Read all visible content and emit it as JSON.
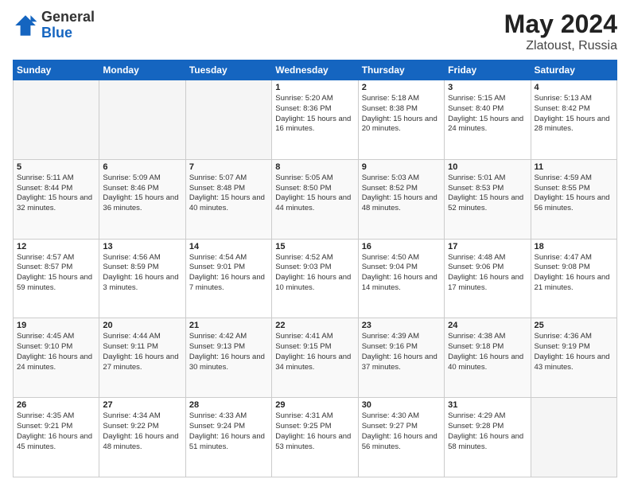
{
  "header": {
    "logo_general": "General",
    "logo_blue": "Blue",
    "title": "May 2024",
    "location": "Zlatoust, Russia"
  },
  "days_of_week": [
    "Sunday",
    "Monday",
    "Tuesday",
    "Wednesday",
    "Thursday",
    "Friday",
    "Saturday"
  ],
  "weeks": [
    [
      {
        "day": "",
        "info": ""
      },
      {
        "day": "",
        "info": ""
      },
      {
        "day": "",
        "info": ""
      },
      {
        "day": "1",
        "info": "Sunrise: 5:20 AM\nSunset: 8:36 PM\nDaylight: 15 hours\nand 16 minutes."
      },
      {
        "day": "2",
        "info": "Sunrise: 5:18 AM\nSunset: 8:38 PM\nDaylight: 15 hours\nand 20 minutes."
      },
      {
        "day": "3",
        "info": "Sunrise: 5:15 AM\nSunset: 8:40 PM\nDaylight: 15 hours\nand 24 minutes."
      },
      {
        "day": "4",
        "info": "Sunrise: 5:13 AM\nSunset: 8:42 PM\nDaylight: 15 hours\nand 28 minutes."
      }
    ],
    [
      {
        "day": "5",
        "info": "Sunrise: 5:11 AM\nSunset: 8:44 PM\nDaylight: 15 hours\nand 32 minutes."
      },
      {
        "day": "6",
        "info": "Sunrise: 5:09 AM\nSunset: 8:46 PM\nDaylight: 15 hours\nand 36 minutes."
      },
      {
        "day": "7",
        "info": "Sunrise: 5:07 AM\nSunset: 8:48 PM\nDaylight: 15 hours\nand 40 minutes."
      },
      {
        "day": "8",
        "info": "Sunrise: 5:05 AM\nSunset: 8:50 PM\nDaylight: 15 hours\nand 44 minutes."
      },
      {
        "day": "9",
        "info": "Sunrise: 5:03 AM\nSunset: 8:52 PM\nDaylight: 15 hours\nand 48 minutes."
      },
      {
        "day": "10",
        "info": "Sunrise: 5:01 AM\nSunset: 8:53 PM\nDaylight: 15 hours\nand 52 minutes."
      },
      {
        "day": "11",
        "info": "Sunrise: 4:59 AM\nSunset: 8:55 PM\nDaylight: 15 hours\nand 56 minutes."
      }
    ],
    [
      {
        "day": "12",
        "info": "Sunrise: 4:57 AM\nSunset: 8:57 PM\nDaylight: 15 hours\nand 59 minutes."
      },
      {
        "day": "13",
        "info": "Sunrise: 4:56 AM\nSunset: 8:59 PM\nDaylight: 16 hours\nand 3 minutes."
      },
      {
        "day": "14",
        "info": "Sunrise: 4:54 AM\nSunset: 9:01 PM\nDaylight: 16 hours\nand 7 minutes."
      },
      {
        "day": "15",
        "info": "Sunrise: 4:52 AM\nSunset: 9:03 PM\nDaylight: 16 hours\nand 10 minutes."
      },
      {
        "day": "16",
        "info": "Sunrise: 4:50 AM\nSunset: 9:04 PM\nDaylight: 16 hours\nand 14 minutes."
      },
      {
        "day": "17",
        "info": "Sunrise: 4:48 AM\nSunset: 9:06 PM\nDaylight: 16 hours\nand 17 minutes."
      },
      {
        "day": "18",
        "info": "Sunrise: 4:47 AM\nSunset: 9:08 PM\nDaylight: 16 hours\nand 21 minutes."
      }
    ],
    [
      {
        "day": "19",
        "info": "Sunrise: 4:45 AM\nSunset: 9:10 PM\nDaylight: 16 hours\nand 24 minutes."
      },
      {
        "day": "20",
        "info": "Sunrise: 4:44 AM\nSunset: 9:11 PM\nDaylight: 16 hours\nand 27 minutes."
      },
      {
        "day": "21",
        "info": "Sunrise: 4:42 AM\nSunset: 9:13 PM\nDaylight: 16 hours\nand 30 minutes."
      },
      {
        "day": "22",
        "info": "Sunrise: 4:41 AM\nSunset: 9:15 PM\nDaylight: 16 hours\nand 34 minutes."
      },
      {
        "day": "23",
        "info": "Sunrise: 4:39 AM\nSunset: 9:16 PM\nDaylight: 16 hours\nand 37 minutes."
      },
      {
        "day": "24",
        "info": "Sunrise: 4:38 AM\nSunset: 9:18 PM\nDaylight: 16 hours\nand 40 minutes."
      },
      {
        "day": "25",
        "info": "Sunrise: 4:36 AM\nSunset: 9:19 PM\nDaylight: 16 hours\nand 43 minutes."
      }
    ],
    [
      {
        "day": "26",
        "info": "Sunrise: 4:35 AM\nSunset: 9:21 PM\nDaylight: 16 hours\nand 45 minutes."
      },
      {
        "day": "27",
        "info": "Sunrise: 4:34 AM\nSunset: 9:22 PM\nDaylight: 16 hours\nand 48 minutes."
      },
      {
        "day": "28",
        "info": "Sunrise: 4:33 AM\nSunset: 9:24 PM\nDaylight: 16 hours\nand 51 minutes."
      },
      {
        "day": "29",
        "info": "Sunrise: 4:31 AM\nSunset: 9:25 PM\nDaylight: 16 hours\nand 53 minutes."
      },
      {
        "day": "30",
        "info": "Sunrise: 4:30 AM\nSunset: 9:27 PM\nDaylight: 16 hours\nand 56 minutes."
      },
      {
        "day": "31",
        "info": "Sunrise: 4:29 AM\nSunset: 9:28 PM\nDaylight: 16 hours\nand 58 minutes."
      },
      {
        "day": "",
        "info": ""
      }
    ]
  ]
}
